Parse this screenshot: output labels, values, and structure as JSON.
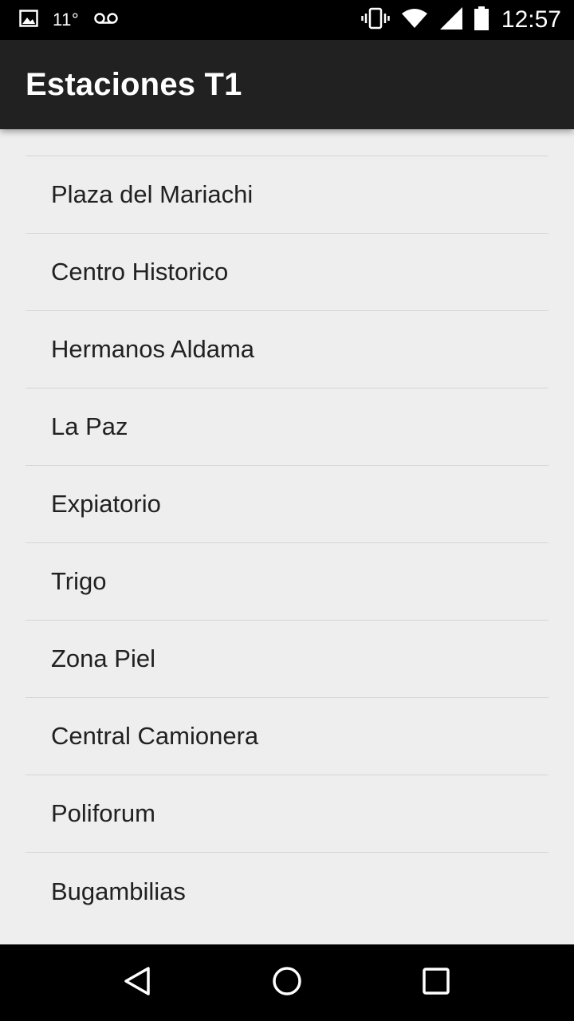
{
  "status_bar": {
    "temperature": "11°",
    "time": "12:57",
    "icons": [
      "image-icon",
      "voicemail-icon",
      "vibrate-icon",
      "wifi-icon",
      "signal-icon",
      "battery-icon"
    ]
  },
  "app_bar": {
    "title": "Estaciones T1"
  },
  "stations": [
    "Plaza del Mariachi",
    "Centro Historico",
    "Hermanos Aldama",
    "La Paz",
    "Expiatorio",
    "Trigo",
    "Zona Piel",
    "Central Camionera",
    "Poliforum",
    "Bugambilias"
  ],
  "nav_bar": {
    "icons": [
      "back-icon",
      "home-icon",
      "recents-icon"
    ]
  },
  "colors": {
    "status_bar": "#000000",
    "app_bar": "#212121",
    "background": "#eeeeee",
    "divider": "#d6d6d6",
    "text": "#212121"
  }
}
